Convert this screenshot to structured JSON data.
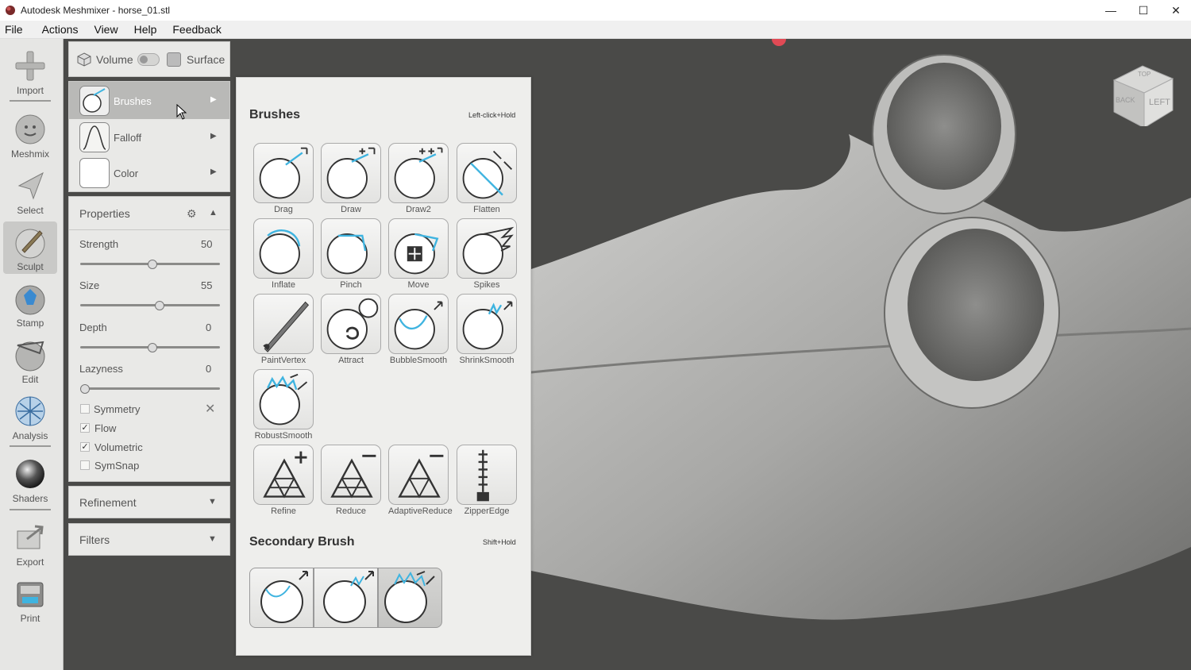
{
  "window": {
    "title": "Autodesk Meshmixer - horse_01.stl",
    "minimize": "—",
    "maximize": "☐",
    "close": "✕"
  },
  "menu": [
    "File",
    "Actions",
    "View",
    "Help",
    "Feedback"
  ],
  "toolbar": {
    "items": [
      {
        "label": "Import",
        "icon": "plus-icon"
      },
      {
        "label": "Meshmix",
        "icon": "meshmix-icon"
      },
      {
        "label": "Select",
        "icon": "select-arrow-icon"
      },
      {
        "label": "Sculpt",
        "icon": "sculpt-brush-icon",
        "active": true
      },
      {
        "label": "Stamp",
        "icon": "stamp-icon"
      },
      {
        "label": "Edit",
        "icon": "edit-icon"
      },
      {
        "label": "Analysis",
        "icon": "analysis-icon"
      },
      {
        "label": "Shaders",
        "icon": "shader-sphere-icon"
      },
      {
        "label": "Export",
        "icon": "export-icon"
      },
      {
        "label": "Print",
        "icon": "print-icon"
      }
    ]
  },
  "mode_toggle": {
    "volume": "Volume",
    "surface": "Surface"
  },
  "brush_panel": {
    "brushes": "Brushes",
    "falloff": "Falloff",
    "color": "Color"
  },
  "properties": {
    "title": "Properties",
    "sliders": [
      {
        "label": "Strength",
        "value": "50",
        "level": 0.5
      },
      {
        "label": "Size",
        "value": "55",
        "level": 0.55
      },
      {
        "label": "Depth",
        "value": "0",
        "level": 0.5
      },
      {
        "label": "Lazyness",
        "value": "0",
        "level": 0.0
      }
    ],
    "checks": [
      {
        "label": "Symmetry",
        "checked": false
      },
      {
        "label": "Flow",
        "checked": true
      },
      {
        "label": "Volumetric",
        "checked": true
      },
      {
        "label": "SymSnap",
        "checked": false
      }
    ]
  },
  "refinement": "Refinement",
  "filters": "Filters",
  "popup": {
    "title": "Brushes",
    "hint": "Left-click+Hold",
    "brushes": [
      "Drag",
      "Draw",
      "Draw2",
      "Flatten",
      "Inflate",
      "Pinch",
      "Move",
      "Spikes",
      "PaintVertex",
      "Attract",
      "BubbleSmooth",
      "ShrinkSmooth",
      "RobustSmooth",
      "Refine",
      "Reduce",
      "AdaptiveReduce",
      "ZipperEdge"
    ],
    "secondary_title": "Secondary Brush",
    "secondary_hint": "Shift+Hold"
  },
  "viewcube": {
    "back": "BACK",
    "left": "LEFT",
    "top": "TOP"
  },
  "colors": {
    "accent": "#3fb4e0",
    "background": "#4a4a48",
    "panel": "#e9e9e7"
  }
}
